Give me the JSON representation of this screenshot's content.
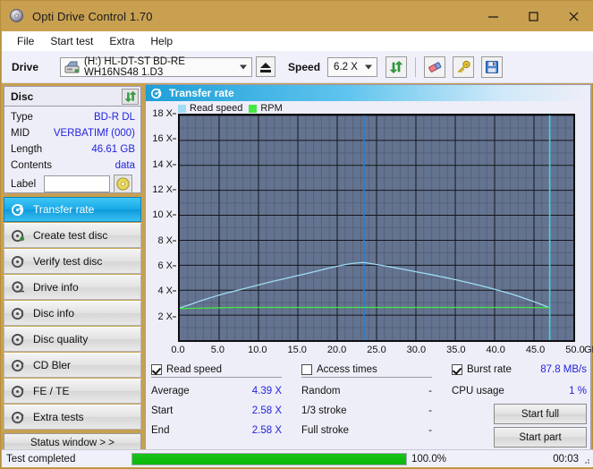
{
  "window": {
    "title": "Opti Drive Control 1.70",
    "icon": "disc-icon",
    "minimize_label": "─",
    "maximize_label": "☐",
    "close_label": "✕"
  },
  "menu": {
    "items": [
      {
        "label": "File"
      },
      {
        "label": "Start test"
      },
      {
        "label": "Extra"
      },
      {
        "label": "Help"
      }
    ]
  },
  "toolbar": {
    "drive_label": "Drive",
    "drive_value": "(H:)  HL-DT-ST BD-RE  WH16NS48 1.D3",
    "eject_icon": "eject-icon",
    "speed_label": "Speed",
    "speed_value": "6.2 X",
    "refresh_icon": "refresh-icon",
    "erase_icon": "eraser-icon",
    "key_icon": "key-icon",
    "save_icon": "save-icon"
  },
  "disc_panel": {
    "title": "Disc",
    "refresh_icon": "refresh-icon",
    "rows": [
      {
        "key": "Type",
        "value": "BD-R DL"
      },
      {
        "key": "MID",
        "value": "VERBATIMf (000)"
      },
      {
        "key": "Length",
        "value": "46.61 GB"
      },
      {
        "key": "Contents",
        "value": "data"
      }
    ],
    "label_key": "Label",
    "label_value": "",
    "label_placeholder": "",
    "label_button_icon": "disc-icon"
  },
  "sidebar": {
    "items": [
      {
        "label": "Transfer rate",
        "icon": "disc-transfer-icon",
        "active": true
      },
      {
        "label": "Create test disc",
        "icon": "disc-write-icon",
        "active": false
      },
      {
        "label": "Verify test disc",
        "icon": "disc-verify-icon",
        "active": false
      },
      {
        "label": "Drive info",
        "icon": "drive-info-icon",
        "active": false
      },
      {
        "label": "Disc info",
        "icon": "disc-info-icon",
        "active": false
      },
      {
        "label": "Disc quality",
        "icon": "disc-quality-icon",
        "active": false
      },
      {
        "label": "CD Bler",
        "icon": "disc-bler-icon",
        "active": false
      },
      {
        "label": "FE / TE",
        "icon": "disc-fete-icon",
        "active": false
      },
      {
        "label": "Extra tests",
        "icon": "disc-extra-icon",
        "active": false
      }
    ],
    "status_window_label": "Status window > >"
  },
  "content": {
    "title": "Transfer rate",
    "title_icon": "transfer-rate-icon"
  },
  "chart_data": {
    "type": "line",
    "title": "Transfer rate",
    "xlabel": "GB",
    "ylabel": "X",
    "xlim": [
      0,
      50
    ],
    "ylim": [
      0,
      18
    ],
    "grid": true,
    "legend_position": "top-left",
    "x_unit": "GB",
    "x_ticks": [
      "0.0",
      "5.0",
      "10.0",
      "15.0",
      "20.0",
      "25.0",
      "30.0",
      "35.0",
      "40.0",
      "45.0",
      "50.0"
    ],
    "x_tick_values": [
      0,
      5,
      10,
      15,
      20,
      25,
      30,
      35,
      40,
      45,
      50
    ],
    "y_ticks": [
      "2 X",
      "4 X",
      "6 X",
      "8 X",
      "10 X",
      "12 X",
      "14 X",
      "16 X",
      "18 X"
    ],
    "y_tick_values": [
      2,
      4,
      6,
      8,
      10,
      12,
      14,
      16,
      18
    ],
    "legend": [
      {
        "name": "Read speed",
        "color": "#9fdcf5"
      },
      {
        "name": "RPM",
        "color": "#44e844"
      }
    ],
    "plot_bg": "#64738f",
    "series": [
      {
        "name": "Read speed",
        "color": "#9fdcf5",
        "x": [
          0.0,
          1.0,
          2.0,
          3.0,
          4.0,
          5.0,
          6.0,
          7.0,
          8.0,
          9.0,
          10.0,
          11.0,
          12.0,
          13.0,
          14.0,
          15.0,
          16.0,
          17.0,
          18.0,
          19.0,
          20.0,
          21.0,
          22.0,
          23.3,
          24.0,
          25.0,
          26.0,
          27.0,
          28.0,
          29.0,
          30.0,
          31.0,
          32.0,
          33.0,
          34.0,
          35.0,
          36.0,
          37.0,
          38.0,
          39.0,
          40.0,
          41.0,
          42.0,
          43.0,
          44.0,
          45.0,
          46.0,
          47.0
        ],
        "y": [
          2.58,
          2.78,
          3.0,
          3.22,
          3.42,
          3.6,
          3.78,
          3.94,
          4.1,
          4.26,
          4.42,
          4.58,
          4.73,
          4.88,
          5.02,
          5.17,
          5.32,
          5.47,
          5.62,
          5.78,
          5.92,
          6.05,
          6.15,
          6.22,
          6.16,
          6.06,
          5.95,
          5.84,
          5.72,
          5.6,
          5.48,
          5.36,
          5.24,
          5.11,
          4.98,
          4.85,
          4.7,
          4.55,
          4.4,
          4.24,
          4.07,
          3.9,
          3.72,
          3.52,
          3.3,
          3.08,
          2.84,
          2.58
        ]
      },
      {
        "name": "RPM",
        "color": "#44e844",
        "x": [
          0.0,
          7.3,
          43.2,
          47.0
        ],
        "y": [
          2.53,
          2.62,
          2.62,
          2.6
        ]
      }
    ],
    "markers": [
      {
        "name": "cursor",
        "x": 23.4,
        "color": "#1f7fe0"
      },
      {
        "name": "layer-break",
        "x": 47.0,
        "color": "#3dd6ee"
      }
    ]
  },
  "stats": {
    "read_speed": {
      "checkbox_label": "Read speed",
      "checked": true,
      "rows": [
        {
          "key": "Average",
          "value": "4.39 X"
        },
        {
          "key": "Start",
          "value": "2.58 X"
        },
        {
          "key": "End",
          "value": "2.58 X"
        }
      ]
    },
    "access_times": {
      "checkbox_label": "Access times",
      "checked": false,
      "rows": [
        {
          "key": "Random",
          "value": "-"
        },
        {
          "key": "1/3 stroke",
          "value": "-"
        },
        {
          "key": "Full stroke",
          "value": "-"
        }
      ]
    },
    "burst": {
      "checkbox_label": "Burst rate",
      "checked": true,
      "value": "87.8 MB/s",
      "cpu_key": "CPU usage",
      "cpu_value": "1 %",
      "start_full_label": "Start full",
      "start_part_label": "Start part"
    }
  },
  "statusbar": {
    "message": "Test completed",
    "progress_percent": 100,
    "progress_text": "100.0%",
    "elapsed": "00:03",
    "progress_color": "#0ab80a"
  }
}
